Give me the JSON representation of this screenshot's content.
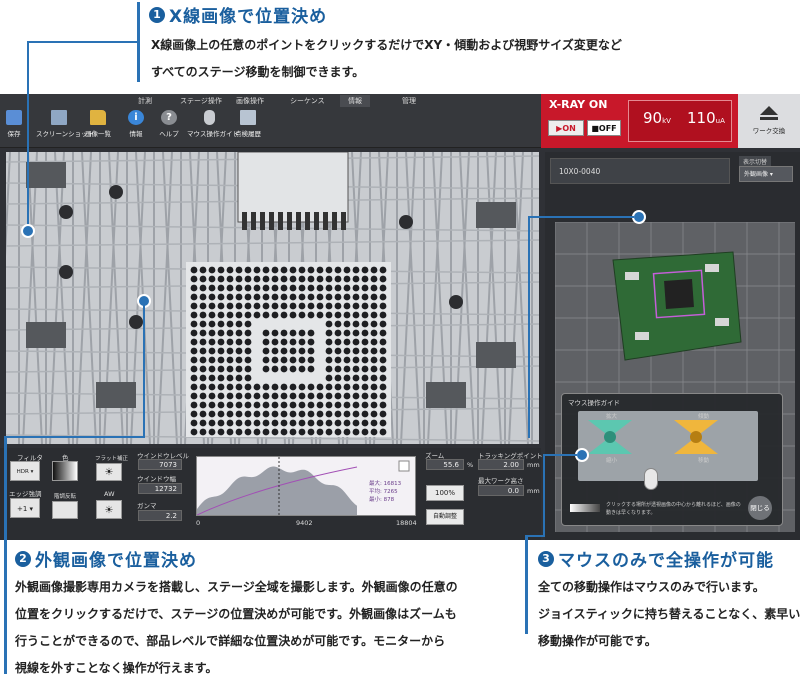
{
  "annotations": {
    "a1": {
      "num": "1",
      "title": "X線画像で位置決め",
      "lines": [
        "X線画像上の任意のポイントをクリックするだけでXY・傾動および視野サイズ変更など",
        "すべてのステージ移動を制御できます。"
      ]
    },
    "a2": {
      "num": "2",
      "title": "外観画像で位置決め",
      "lines": [
        "外観画像撮影専用カメラを搭載し、ステージ全域を撮影します。外観画像の任意の",
        "位置をクリックするだけで、ステージの位置決めが可能です。外観画像はズームも",
        "行うことができるので、部品レベルで詳細な位置決めが可能です。モニターから",
        "視線を外すことなく操作が行えます。"
      ]
    },
    "a3": {
      "num": "3",
      "title": "マウスのみで全操作が可能",
      "lines": [
        "全ての移動操作はマウスのみで行います。",
        "ジョイスティックに持ち替えることなく、素早い",
        "移動操作が可能です。"
      ]
    }
  },
  "ribbon": {
    "tabs": [
      "計測",
      "ステージ操作",
      "画像操作",
      "シーケンス",
      "情報",
      "管理"
    ],
    "buttons": [
      "保存",
      "スクリーンショット",
      "画像一覧",
      "情報",
      "ヘルプ",
      "マウス操作ガイド",
      "点検履歴"
    ]
  },
  "xray": {
    "title": "X-RAY ON",
    "on_label": "▶ON",
    "off_label": "■OFF",
    "kv": "90",
    "kv_unit": "kV",
    "ua": "110",
    "ua_unit": "uA"
  },
  "work_swap": "ワーク交換",
  "controls": {
    "filter_label": "フィルタ",
    "filter_value": "HDR",
    "color_label": "色",
    "shade_label": "フラット補正",
    "edge_label": "エッジ強調",
    "edge_value": "+1",
    "invert_label": "階調反転",
    "aw_label": "AW",
    "window_level_label": "ウインドウレベル",
    "window_level": "7073",
    "window_width_label": "ウインドウ幅",
    "window_width": "12732",
    "gamma_label": "ガンマ",
    "gamma": "2.2",
    "zoom_label": "ズーム",
    "zoom": "55.6",
    "zoom_unit": "%",
    "zoom100": "100%",
    "tracking_label": "トラッキングポイント",
    "tracking": "2.00",
    "tracking_unit": "mm",
    "max_height_label": "最大ワーク高さ",
    "max_height": "0.0",
    "max_height_unit": "mm",
    "auto_adjust": "自動調整"
  },
  "histogram": {
    "max_label": "最大:",
    "max": "16813",
    "avg_label": "平均:",
    "avg": "7265",
    "min_label": "最小:",
    "min": "878",
    "axis": [
      "0",
      "9402",
      "18804"
    ]
  },
  "camera": {
    "id": "10X0-0040",
    "view_label": "表示切替",
    "view_value": "外観画像"
  },
  "guide": {
    "title": "マウス操作ガイド",
    "zoom_in": "拡大",
    "zoom_out": "縮小",
    "tilt": "傾動",
    "move": "移動",
    "hint": "クリックする場所が透視画像の中心から離れるほど、画像の動きは早くなります。",
    "close": "閉じる"
  }
}
